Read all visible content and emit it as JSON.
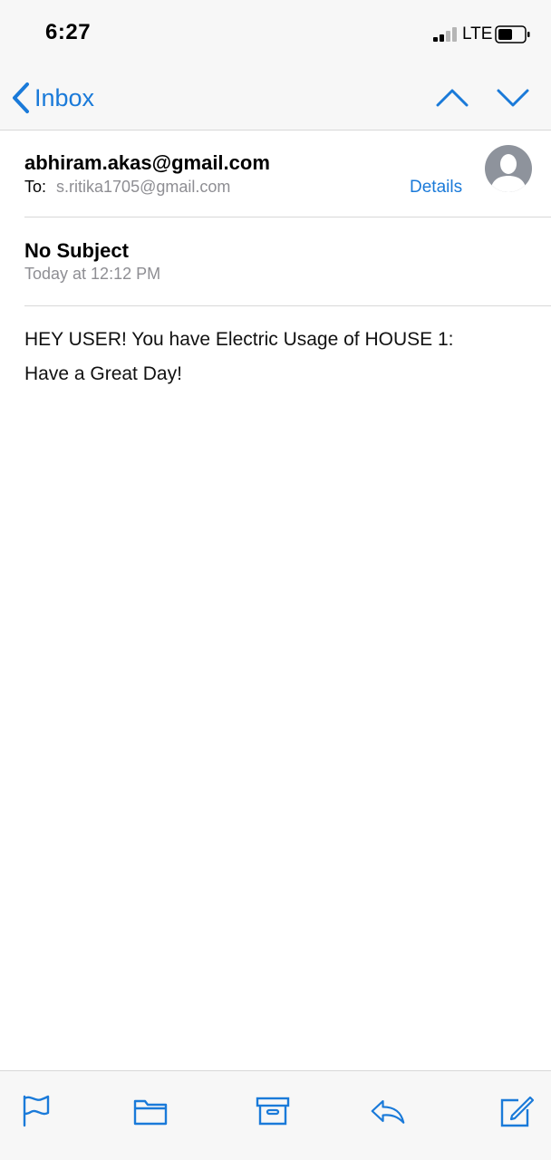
{
  "status_bar": {
    "time": "6:27",
    "network": "LTE"
  },
  "nav": {
    "back_label": "Inbox"
  },
  "email": {
    "from": "abhiram.akas@gmail.com",
    "to_label": "To:",
    "to": "s.ritika1705@gmail.com",
    "details_label": "Details",
    "subject": "No Subject",
    "date": "Today at 12:12 PM",
    "body_lines": [
      "HEY USER! You have Electric Usage of HOUSE 1:",
      "Have a Great Day!"
    ]
  },
  "colors": {
    "accent": "#1a7ad9",
    "secondary_text": "#8e8e93",
    "bar_background": "#f7f7f7"
  },
  "toolbar": {
    "icons": [
      "flag-icon",
      "folder-icon",
      "archive-icon",
      "reply-icon",
      "compose-icon"
    ]
  }
}
